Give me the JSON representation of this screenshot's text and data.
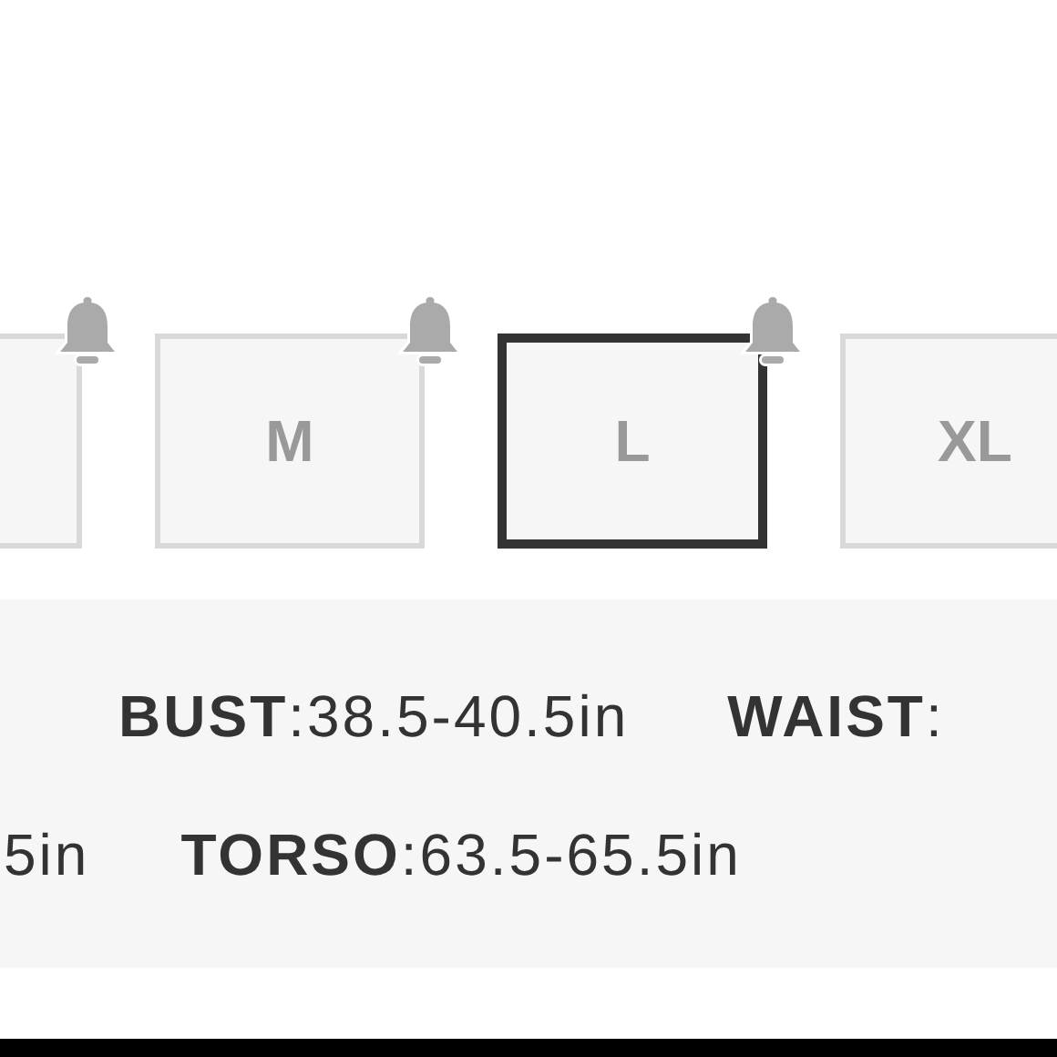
{
  "sizes": [
    {
      "kind": "partial",
      "bell": {
        "on": true
      }
    },
    {
      "kind": "size",
      "label": "M",
      "selected": false,
      "bell": {
        "on": true
      }
    },
    {
      "kind": "size",
      "label": "L",
      "selected": true,
      "bell": {
        "on": true
      }
    },
    {
      "kind": "size",
      "label": "XL",
      "selected": false,
      "bell": {
        "on": false
      }
    }
  ],
  "measurements": [
    [
      {
        "kind": "measure",
        "label": "BUST",
        "value": ":38.5-40.5in"
      },
      {
        "kind": "measure",
        "label": "WAIST",
        "value": ":"
      }
    ],
    [
      {
        "kind": "fragment",
        "text": "5in"
      },
      {
        "kind": "measure",
        "label": "TORSO",
        "value": ":63.5-65.5in"
      }
    ]
  ]
}
